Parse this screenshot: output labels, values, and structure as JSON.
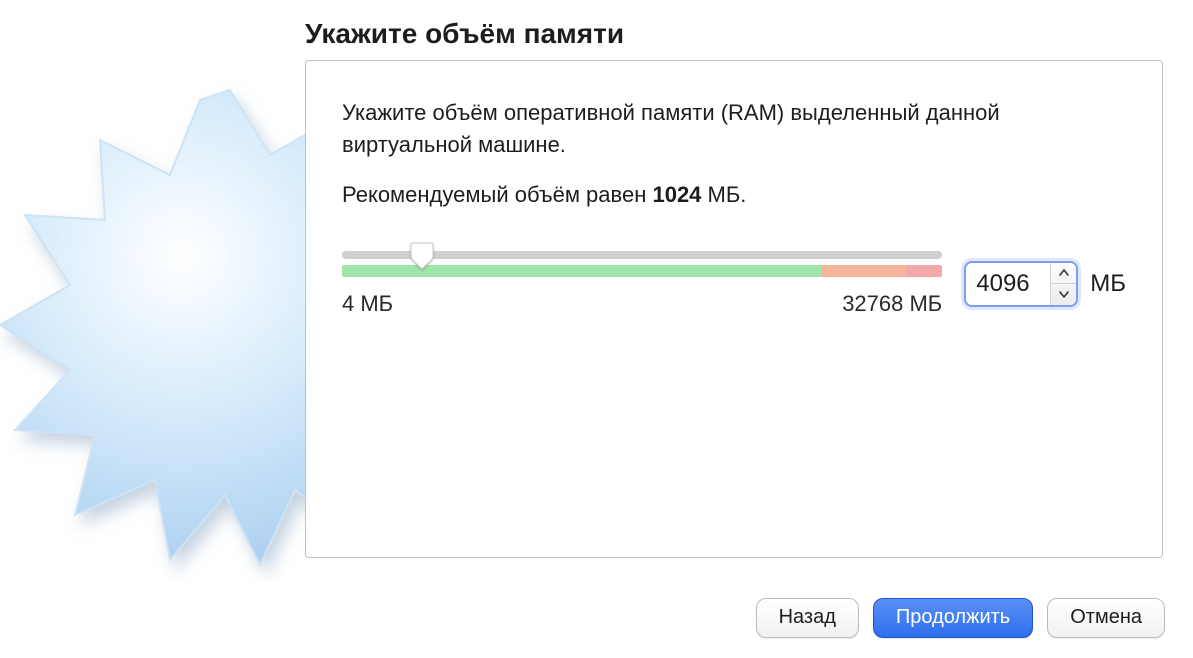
{
  "title": "Укажите объём памяти",
  "description": "Укажите объём оперативной памяти (RAM) выделенный данной виртуальной машине.",
  "recommendation_prefix": "Рекомендуемый объём равен ",
  "recommendation_value": "1024",
  "recommendation_suffix": " МБ.",
  "slider": {
    "min_label": "4 МБ",
    "max_label": "32768 МБ",
    "value": "4096",
    "unit": "МБ"
  },
  "buttons": {
    "back": "Назад",
    "continue": "Продолжить",
    "cancel": "Отмена"
  }
}
